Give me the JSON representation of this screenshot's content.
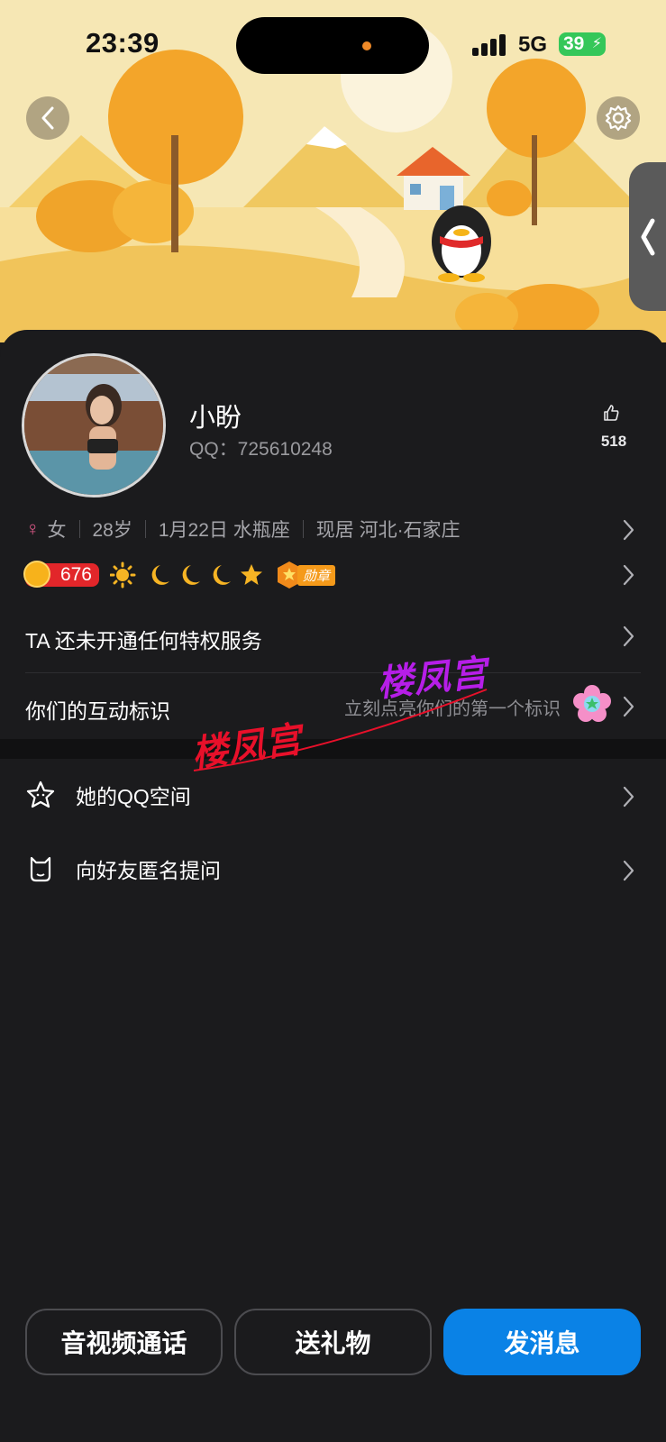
{
  "status_bar": {
    "time": "23:39",
    "network": "5G",
    "battery": "39"
  },
  "profile": {
    "name": "小盼",
    "qq_label": "QQ：725610248",
    "likes": "518",
    "gender": "女",
    "age": "28岁",
    "birthday": "1月22日 水瓶座",
    "location": "现居 河北·石家庄",
    "level": "676",
    "medal_label": "勋章"
  },
  "rows": {
    "privilege": "TA 还未开通任何特权服务",
    "interaction_title": "你们的互动标识",
    "interaction_hint": "立刻点亮你们的第一个标识"
  },
  "menu": [
    {
      "label": "她的QQ空间",
      "icon": "star-face-icon"
    },
    {
      "label": "向好友匿名提问",
      "icon": "cat-icon"
    }
  ],
  "watermark": [
    "楼凤宫",
    "楼凤宫"
  ],
  "buttons": {
    "call": "音视频通话",
    "gift": "送礼物",
    "message": "发消息"
  },
  "colors": {
    "primary": "#0a82e6",
    "background": "#1b1b1d",
    "level_red": "#e2262a",
    "medal_orange": "#f59a1a"
  }
}
